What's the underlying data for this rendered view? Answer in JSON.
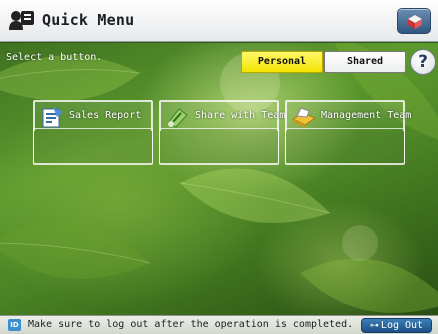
{
  "header": {
    "title": "Quick Menu",
    "title_icon": "quick-menu-icon",
    "top_right_icon": "system-monitor-icon"
  },
  "prompt": "Select a button.",
  "toggles": {
    "personal": "Personal",
    "shared": "Shared",
    "active": "personal",
    "active_color": "#f3e300"
  },
  "help": {
    "label": "?"
  },
  "menu_buttons": [
    {
      "label": "Sales Report",
      "icon": "report-icon"
    },
    {
      "label": "Share with Team",
      "icon": "share-icon"
    },
    {
      "label": "Management Team",
      "icon": "printer-icon"
    }
  ],
  "status": {
    "badge": "ID",
    "message": "Make sure to log out after the operation is completed.",
    "logout_label": "Log Out"
  }
}
